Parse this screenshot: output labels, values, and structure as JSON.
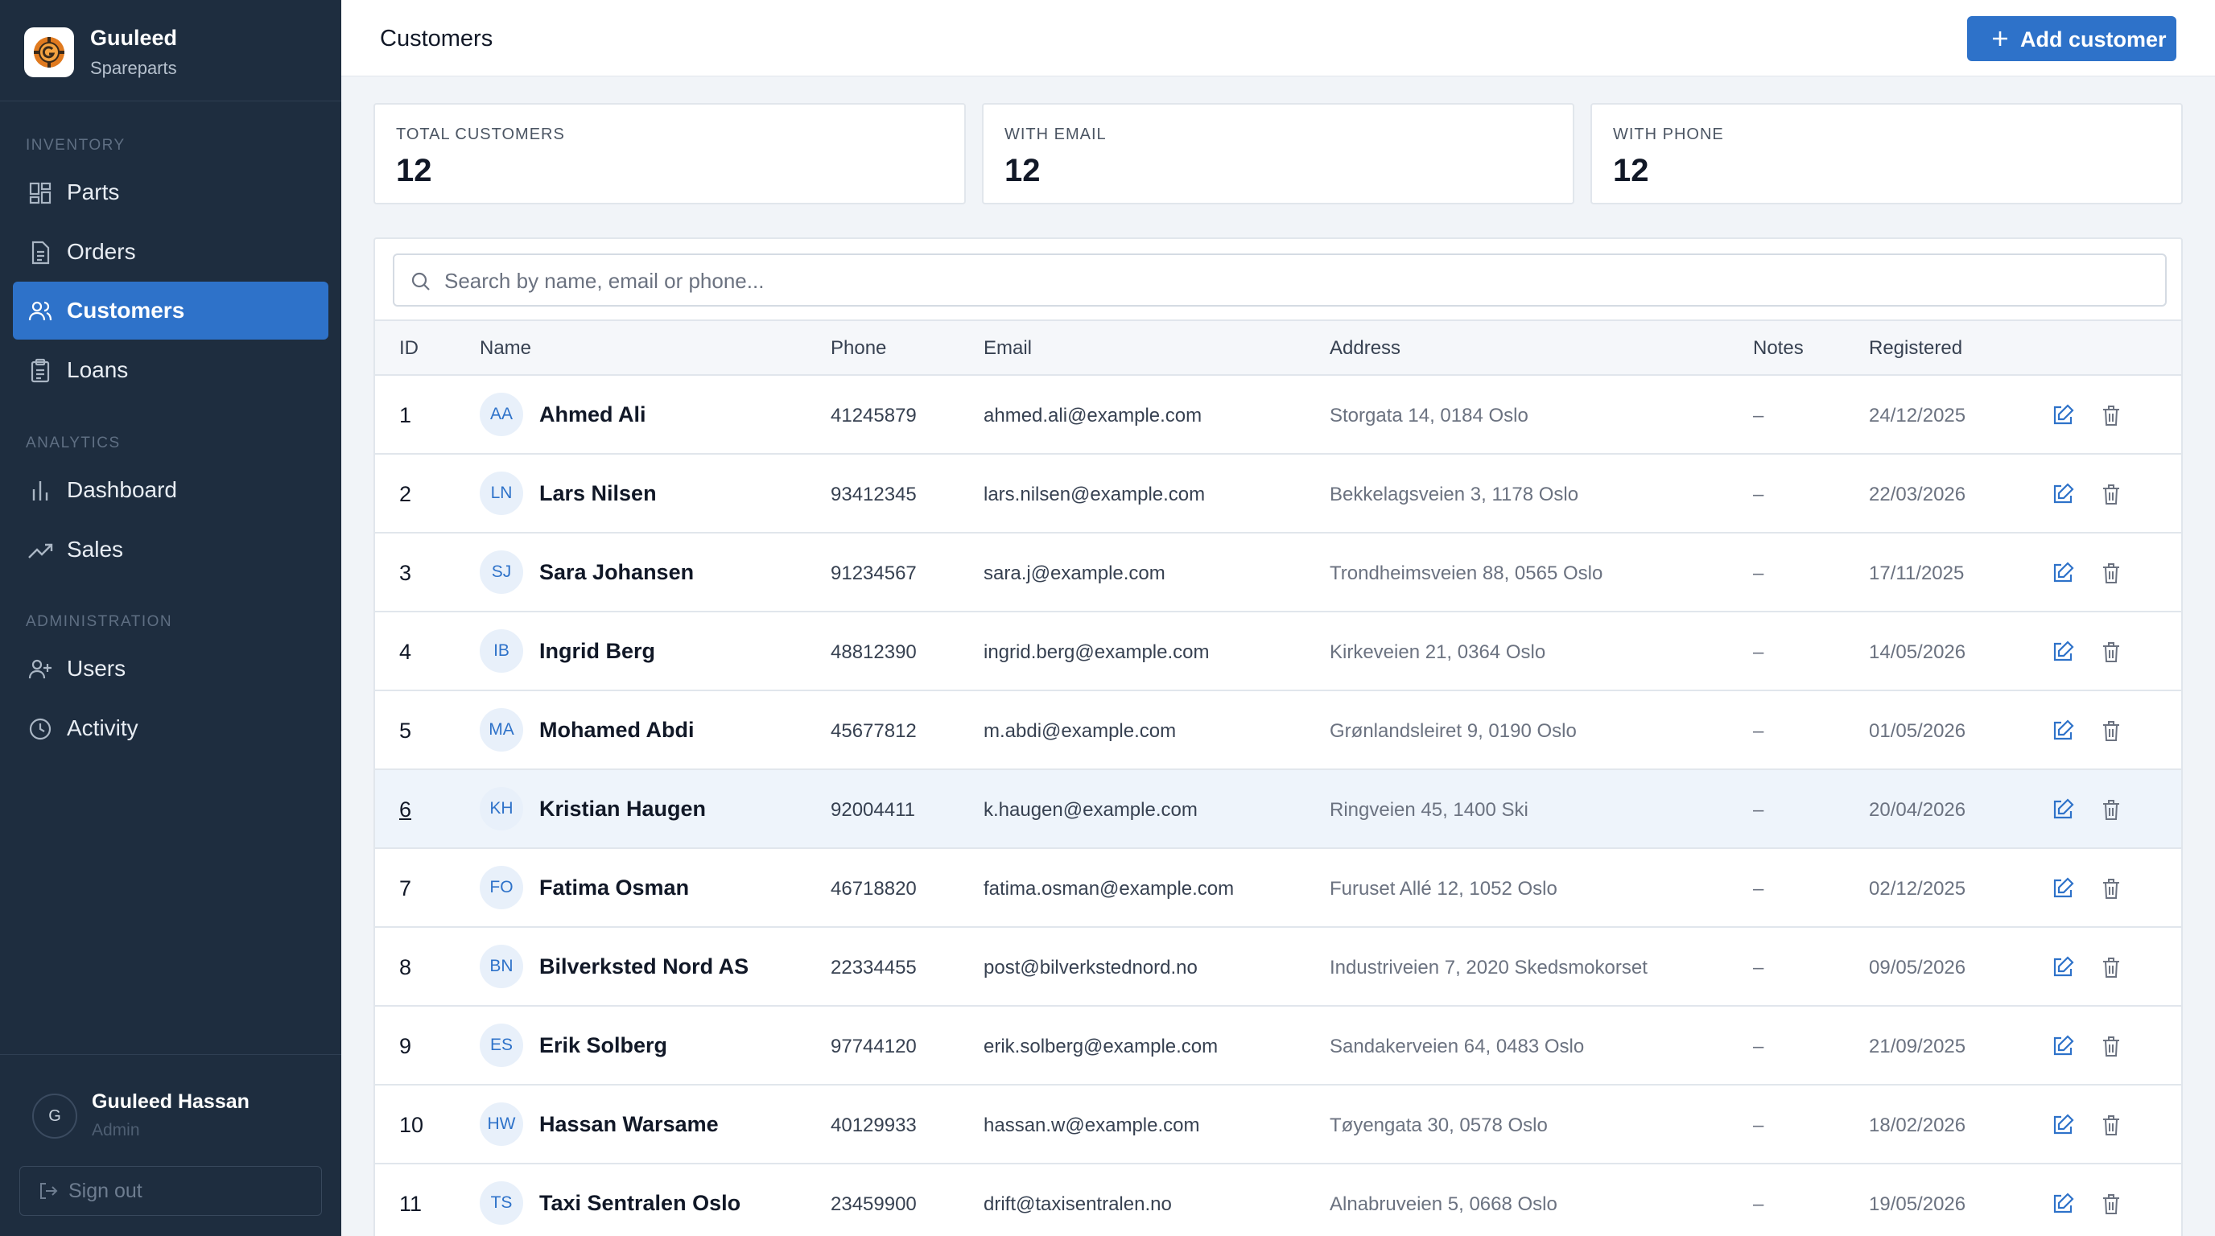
{
  "brand": {
    "name": "Guuleed",
    "subtitle": "Spareparts"
  },
  "nav": {
    "sections": [
      {
        "title": "INVENTORY"
      },
      {
        "title": "ANALYTICS"
      },
      {
        "title": "ADMINISTRATION"
      }
    ],
    "items": [
      {
        "label": "Parts",
        "icon": "grid-icon"
      },
      {
        "label": "Orders",
        "icon": "document-icon"
      },
      {
        "label": "Customers",
        "icon": "users-icon",
        "active": true
      },
      {
        "label": "Loans",
        "icon": "clipboard-icon"
      },
      {
        "label": "Dashboard",
        "icon": "bar-chart-icon"
      },
      {
        "label": "Sales",
        "icon": "trending-up-icon"
      },
      {
        "label": "Users",
        "icon": "user-plus-icon"
      },
      {
        "label": "Activity",
        "icon": "clock-icon"
      }
    ]
  },
  "user": {
    "initial": "G",
    "name": "Guuleed Hassan",
    "role": "Admin",
    "signout_label": "Sign out"
  },
  "header": {
    "title": "Customers",
    "add_label": "Add customer"
  },
  "stats": [
    {
      "label": "TOTAL CUSTOMERS",
      "value": "12"
    },
    {
      "label": "WITH EMAIL",
      "value": "12"
    },
    {
      "label": "WITH PHONE",
      "value": "12"
    }
  ],
  "search": {
    "placeholder": "Search by name, email or phone...",
    "value": ""
  },
  "table": {
    "columns": [
      "ID",
      "Name",
      "Phone",
      "Email",
      "Address",
      "Notes",
      "Registered"
    ],
    "rows": [
      {
        "id": "1",
        "initials": "AA",
        "name": "Ahmed Ali",
        "phone": "41245879",
        "email": "ahmed.ali@example.com",
        "address": "Storgata 14, 0184 Oslo",
        "notes": "–",
        "registered": "24/12/2025"
      },
      {
        "id": "2",
        "initials": "LN",
        "name": "Lars Nilsen",
        "phone": "93412345",
        "email": "lars.nilsen@example.com",
        "address": "Bekkelagsveien 3, 1178 Oslo",
        "notes": "–",
        "registered": "22/03/2026"
      },
      {
        "id": "3",
        "initials": "SJ",
        "name": "Sara Johansen",
        "phone": "91234567",
        "email": "sara.j@example.com",
        "address": "Trondheimsveien 88, 0565 Oslo",
        "notes": "–",
        "registered": "17/11/2025"
      },
      {
        "id": "4",
        "initials": "IB",
        "name": "Ingrid Berg",
        "phone": "48812390",
        "email": "ingrid.berg@example.com",
        "address": "Kirkeveien 21, 0364 Oslo",
        "notes": "–",
        "registered": "14/05/2026"
      },
      {
        "id": "5",
        "initials": "MA",
        "name": "Mohamed Abdi",
        "phone": "45677812",
        "email": "m.abdi@example.com",
        "address": "Grønlandsleiret 9, 0190 Oslo",
        "notes": "–",
        "registered": "01/05/2026"
      },
      {
        "id": "6",
        "initials": "KH",
        "name": "Kristian Haugen",
        "phone": "92004411",
        "email": "k.haugen@example.com",
        "address": "Ringveien 45, 1400 Ski",
        "notes": "–",
        "registered": "20/04/2026",
        "highlight": true
      },
      {
        "id": "7",
        "initials": "FO",
        "name": "Fatima Osman",
        "phone": "46718820",
        "email": "fatima.osman@example.com",
        "address": "Furuset Allé 12, 1052 Oslo",
        "notes": "–",
        "registered": "02/12/2025"
      },
      {
        "id": "8",
        "initials": "BN",
        "name": "Bilverksted Nord AS",
        "phone": "22334455",
        "email": "post@bilverkstednord.no",
        "address": "Industriveien 7, 2020 Skedsmokorset",
        "notes": "–",
        "registered": "09/05/2026"
      },
      {
        "id": "9",
        "initials": "ES",
        "name": "Erik Solberg",
        "phone": "97744120",
        "email": "erik.solberg@example.com",
        "address": "Sandakerveien 64, 0483 Oslo",
        "notes": "–",
        "registered": "21/09/2025"
      },
      {
        "id": "10",
        "initials": "HW",
        "name": "Hassan Warsame",
        "phone": "40129933",
        "email": "hassan.w@example.com",
        "address": "Tøyengata 30, 0578 Oslo",
        "notes": "–",
        "registered": "18/02/2026"
      },
      {
        "id": "11",
        "initials": "TS",
        "name": "Taxi Sentralen Oslo",
        "phone": "23459900",
        "email": "drift@taxisentralen.no",
        "address": "Alnabruveien 5, 0668 Oslo",
        "notes": "–",
        "registered": "19/05/2026"
      }
    ]
  },
  "colors": {
    "sidebar": "#1e2d3f",
    "accent": "#2e72c9",
    "background": "#f1f4f8"
  }
}
